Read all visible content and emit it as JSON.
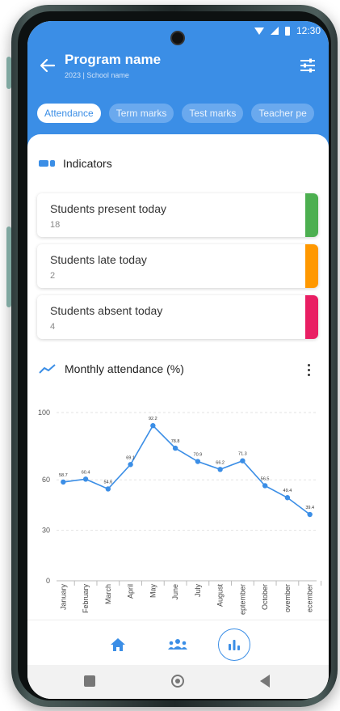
{
  "status": {
    "time": "12:30"
  },
  "header": {
    "title": "Program name",
    "subtitle": "2023 | School name"
  },
  "tabs": [
    {
      "label": "Attendance",
      "active": true
    },
    {
      "label": "Term marks",
      "active": false
    },
    {
      "label": "Test marks",
      "active": false
    },
    {
      "label": "Teacher pe",
      "active": false
    }
  ],
  "indicators": {
    "title": "Indicators",
    "cards": [
      {
        "label": "Students present today",
        "value": "18",
        "color": "#4caf50"
      },
      {
        "label": "Students late today",
        "value": "2",
        "color": "#ff9800"
      },
      {
        "label": "Students absent today",
        "value": "4",
        "color": "#e91e63"
      }
    ]
  },
  "chart_section": {
    "title": "Monthly attendance (%)"
  },
  "chart_data": {
    "type": "line",
    "categories": [
      "January",
      "February",
      "March",
      "April",
      "May",
      "June",
      "July",
      "August",
      "eptember",
      "October",
      "ovember",
      "ecember"
    ],
    "values": [
      58.7,
      60.4,
      54.6,
      69.1,
      92.2,
      78.8,
      70.9,
      66.2,
      71.3,
      56.5,
      49.4,
      39.4
    ],
    "ylim": [
      0,
      100
    ],
    "yticks": [
      0,
      30,
      60,
      100
    ],
    "grid": true,
    "line_color": "#3b8ee6"
  },
  "nav": {
    "items": [
      {
        "name": "home",
        "icon": "home-icon"
      },
      {
        "name": "people",
        "icon": "people-icon"
      },
      {
        "name": "stats",
        "icon": "bar-chart-icon",
        "active": true
      }
    ]
  },
  "colors": {
    "primary": "#3b8ee6"
  }
}
